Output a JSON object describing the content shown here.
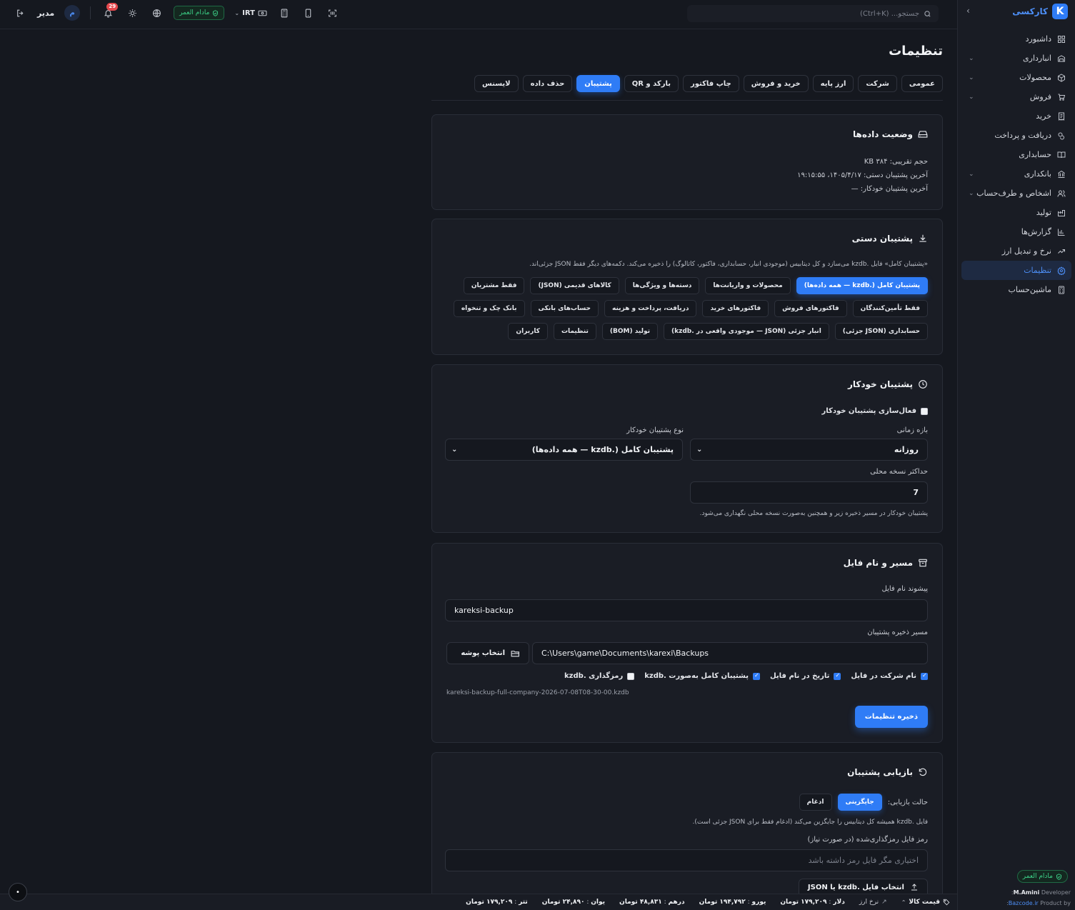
{
  "sidebar": {
    "brand": "کارکسی",
    "brand_letter": "K",
    "items": [
      {
        "label": "داشبورد",
        "icon": "dashboard-icon",
        "chevron": false
      },
      {
        "label": "انبارداری",
        "icon": "warehouse-icon",
        "chevron": true
      },
      {
        "label": "محصولات",
        "icon": "package-icon",
        "chevron": true
      },
      {
        "label": "فروش",
        "icon": "cart-icon",
        "chevron": true
      },
      {
        "label": "خرید",
        "icon": "receipt-icon",
        "chevron": false
      },
      {
        "label": "دریافت و پرداخت",
        "icon": "payment-icon",
        "chevron": false
      },
      {
        "label": "حسابداری",
        "icon": "book-icon",
        "chevron": false
      },
      {
        "label": "بانکداری",
        "icon": "bank-icon",
        "chevron": true
      },
      {
        "label": "اشخاص و طرف‌حساب",
        "icon": "users-icon",
        "chevron": true
      },
      {
        "label": "تولید",
        "icon": "factory-icon",
        "chevron": false
      },
      {
        "label": "گزارش‌ها",
        "icon": "chart-icon",
        "chevron": false
      },
      {
        "label": "نرخ و تبدیل ارز",
        "icon": "trend-icon",
        "chevron": false
      },
      {
        "label": "تنظیمات",
        "icon": "gear-icon",
        "chevron": false,
        "active": true
      },
      {
        "label": "ماشین‌حساب",
        "icon": "calculator-icon",
        "chevron": false
      }
    ],
    "company_badge": "مادام العمر",
    "developer_label": "Developer:",
    "developer_name": "M.Amini",
    "product_label": "Product by:",
    "product_link": "Bazcode.ir"
  },
  "topbar": {
    "search_placeholder": "جستجو... (Ctrl+K)",
    "company_badge": "مادام العمر",
    "currency": "IRT",
    "notifications_count": "29",
    "user_initial": "م",
    "user_name": "مدیر"
  },
  "page": {
    "title": "تنظیمات",
    "tabs": [
      "عمومی",
      "شرکت",
      "ارز پایه",
      "خرید و فروش",
      "چاپ فاکتور",
      "بارکد و QR",
      "پشتیبان",
      "حذف داده",
      "لایسنس"
    ],
    "active_tab": "پشتیبان"
  },
  "data_status": {
    "title": "وضعیت داده‌ها",
    "size_line": "حجم تقریبی: ۳۸۴ KB",
    "last_manual": "آخرین پشتیبان دستی: ۱۴۰۵/۴/۱۷، ۱۹:۱۵:۵۵",
    "last_auto": "آخرین پشتیبان خودکار: —"
  },
  "manual_backup": {
    "title": "پشتیبان دستی",
    "description": "«پشتیبان کامل» فایل .kzdb می‌سازد و کل دیتابیس (موجودی انبار، حسابداری، فاکتور، کاتالوگ) را ذخیره می‌کند. دکمه‌های دیگر فقط JSON جزئی‌اند.",
    "rows": [
      [
        "پشتیبان کامل (.kzdb — همه داده‌ها)",
        "محصولات و واریانت‌ها",
        "دسته‌ها و ویژگی‌ها",
        "کالاهای قدیمی (JSON)",
        "فقط مشتریان"
      ],
      [
        "فقط تأمین‌کنندگان",
        "فاکتورهای فروش",
        "فاکتورهای خرید",
        "دریافت، پرداخت و هزینه",
        "حساب‌های بانکی",
        "بانک چک و تنخواه"
      ],
      [
        "حسابداری (JSON جزئی)",
        "انبار جزئی (JSON — موجودی واقعی در .kzdb)",
        "تولید (BOM)",
        "تنظیمات",
        "کاربران"
      ]
    ]
  },
  "auto_backup": {
    "title": "پشتیبان خودکار",
    "enable_label": "فعال‌سازی پشتیبان خودکار",
    "interval_label": "بازه زمانی",
    "interval_value": "روزانه",
    "type_label": "نوع پشتیبان خودکار",
    "type_value": "پشتیبان کامل (.kzdb — همه داده‌ها)",
    "max_label": "حداکثر نسخه محلی",
    "max_value": "7",
    "note": "پشتیبان خودکار در مسیر ذخیره زیر و همچنین به‌صورت نسخه محلی نگهداری می‌شود."
  },
  "path_card": {
    "title": "مسیر و نام فایل",
    "prefix_label": "پیشوند نام فایل",
    "prefix_value": "kareksi-backup",
    "path_label": "مسیر ذخیره پشتیبان",
    "path_value": "C:\\Users\\game\\Documents\\karexi\\Backups",
    "folder_button": "انتخاب پوشه",
    "cb_company": "نام شرکت در فایل",
    "cb_date": "تاریخ در نام فایل",
    "cb_full": "پشتیبان کامل به‌صورت .kzdb",
    "cb_encrypt": "رمزگذاری .kzdb",
    "filename_preview": "kareksi-backup-full-company-2026-07-08T08-30-00.kzdb",
    "save_button": "ذخیره تنظیمات"
  },
  "restore": {
    "title": "بازیابی پشتیبان",
    "mode_label": "حالت بازیابی:",
    "mode_replace": "جایگزینی",
    "mode_merge": "ادغام",
    "note": "فایل .kzdb همیشه کل دیتابیس را جایگزین می‌کند (ادغام فقط برای JSON جزئی است).",
    "password_label": "رمز فایل رمزگذاری‌شده (در صورت نیاز)",
    "password_placeholder": "اختیاری مگر فایل رمز داشته باشد",
    "select_file_button": "انتخاب فایل .kzdb یا JSON"
  },
  "bottombar": {
    "price_label": "قیمت کالا",
    "rate_label": "نرخ ارز",
    "rates": [
      {
        "name": "دلار",
        "value": "۱۷۹,۲۰۹ تومان"
      },
      {
        "name": "یورو",
        "value": "۱۹۴,۷۹۲ تومان"
      },
      {
        "name": "درهم",
        "value": "۴۸,۸۳۱ تومان"
      },
      {
        "name": "یوان",
        "value": "۲۴,۸۹۰ تومان"
      },
      {
        "name": "تتر",
        "value": "۱۷۹,۲۰۹ تومان"
      }
    ]
  },
  "colors": {
    "accent": "#2f7cf6",
    "success": "#3ccf87",
    "background": "#15181f",
    "card": "#1a1d25"
  }
}
